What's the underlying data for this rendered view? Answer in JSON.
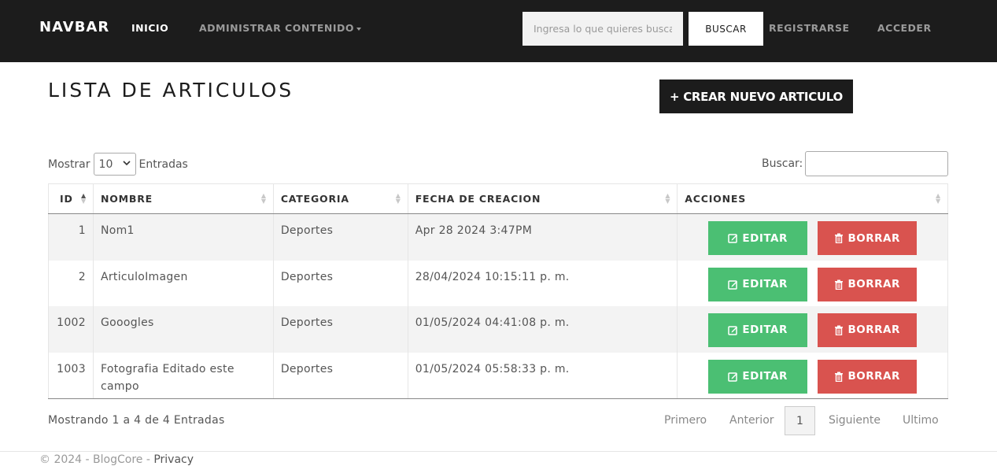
{
  "navbar": {
    "brand": "NAVBAR",
    "links": {
      "inicio": "INICIO",
      "admin": "ADMINISTRAR CONTENIDO",
      "register": "REGISTRARSE",
      "login": "ACCEDER"
    },
    "search_placeholder": "Ingresa lo que quieres buscar",
    "search_button": "BUSCAR"
  },
  "page": {
    "title": "LISTA DE ARTICULOS",
    "create_button": "+ CREAR NUEVO ARTICULO"
  },
  "table_controls": {
    "show_label": "Mostrar",
    "page_length": "10",
    "entries_label": "Entradas",
    "search_label": "Buscar:"
  },
  "table": {
    "headers": [
      "ID",
      "NOMBRE",
      "CATEGORIA",
      "FECHA DE CREACION",
      "ACCIONES"
    ],
    "rows": [
      {
        "id": "1",
        "nombre": "Nom1",
        "categoria": "Deportes",
        "fecha": "Apr 28 2024 3:47PM"
      },
      {
        "id": "2",
        "nombre": "ArticuloImagen",
        "categoria": "Deportes",
        "fecha": "28/04/2024 10:15:11 p. m."
      },
      {
        "id": "1002",
        "nombre": "Gooogles",
        "categoria": "Deportes",
        "fecha": "01/05/2024 04:41:08 p. m."
      },
      {
        "id": "1003",
        "nombre": "Fotografia Editado este campo",
        "categoria": "Deportes",
        "fecha": "01/05/2024 05:58:33 p. m."
      }
    ],
    "edit_label": "EDITAR",
    "delete_label": "BORRAR"
  },
  "pagination": {
    "info": "Mostrando 1 a 4 de 4 Entradas",
    "first": "Primero",
    "previous": "Anterior",
    "current": "1",
    "next": "Siguiente",
    "last": "Ultimo"
  },
  "footer": {
    "text": "© 2024 - BlogCore - ",
    "privacy": "Privacy"
  },
  "colors": {
    "navbar": "#1c1c1c",
    "edit": "#4bbf73",
    "delete": "#d9534f"
  },
  "icons": {
    "edit": "edit-icon",
    "delete": "trash-icon",
    "sort": "sort-icon"
  }
}
